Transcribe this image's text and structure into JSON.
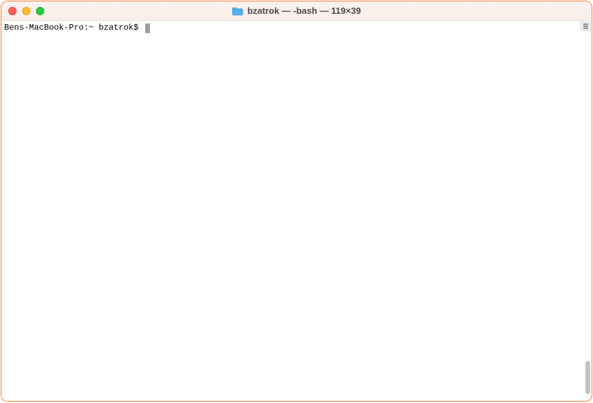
{
  "window": {
    "title": "bzatrok — -bash — 119×39"
  },
  "terminal": {
    "prompt": "Bens-MacBook-Pro:~ bzatrok$ "
  },
  "icons": {
    "folder": "folder-icon"
  }
}
